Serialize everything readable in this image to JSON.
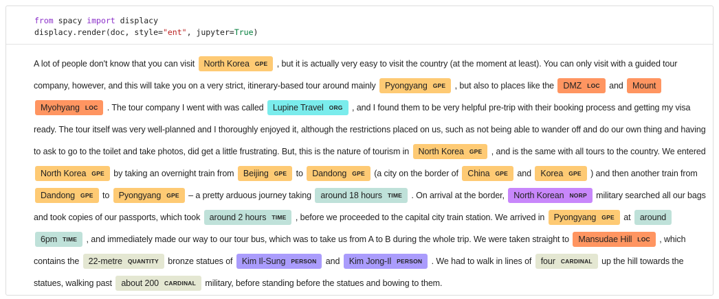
{
  "code": {
    "line1": {
      "kw1": "from",
      "mod": " spacy ",
      "kw2": "import",
      "name": " displacy"
    },
    "line2": {
      "pre": "displacy.render(doc, style=",
      "str": "\"ent\"",
      "mid": ", jupyter=",
      "val": "True",
      "post": ")"
    }
  },
  "segments": [
    {
      "t": "A lot of people don't know that you can visit "
    },
    {
      "e": "North Korea",
      "l": "GPE"
    },
    {
      "t": " , but it is actually very easy to visit the country (at the moment at least). You can only visit with a guided tour company, however, and this will take you on a very strict, itinerary-based tour around mainly "
    },
    {
      "e": "Pyongyang",
      "l": "GPE"
    },
    {
      "t": " , but also to places like the "
    },
    {
      "e": "DMZ",
      "l": "LOC"
    },
    {
      "t": " and "
    },
    {
      "e": "Mount Myohyang",
      "l": "LOC"
    },
    {
      "t": " . The tour company I went with was called "
    },
    {
      "e": "Lupine Travel",
      "l": "ORG"
    },
    {
      "t": " , and I found them to be very helpful pre-trip with their booking process and getting my visa ready. The tour itself was very well-planned and I thoroughly enjoyed it, although the restrictions placed on us, such as not being able to wander off and do our own thing and having to ask to go to the toilet and take photos, did get a little frustrating. But, this is the nature of tourism in "
    },
    {
      "e": "North Korea",
      "l": "GPE"
    },
    {
      "t": " , and is the same with all tours to the country. We entered "
    },
    {
      "e": "North Korea",
      "l": "GPE"
    },
    {
      "t": " by taking an overnight train from "
    },
    {
      "e": "Beijing",
      "l": "GPE"
    },
    {
      "t": " to "
    },
    {
      "e": "Dandong",
      "l": "GPE"
    },
    {
      "t": " (a city on the border of "
    },
    {
      "e": "China",
      "l": "GPE"
    },
    {
      "t": " and "
    },
    {
      "e": "Korea",
      "l": "GPE"
    },
    {
      "t": " ) and then another train from "
    },
    {
      "e": "Dandong",
      "l": "GPE"
    },
    {
      "t": " to "
    },
    {
      "e": "Pyongyang",
      "l": "GPE"
    },
    {
      "t": " – a pretty arduous journey taking "
    },
    {
      "e": "around 18 hours",
      "l": "TIME"
    },
    {
      "t": " . On arrival at the border, "
    },
    {
      "e": "North Korean",
      "l": "NORP"
    },
    {
      "t": " military searched all our bags and took copies of our passports, which took "
    },
    {
      "e": "around 2 hours",
      "l": "TIME"
    },
    {
      "t": " , before we proceeded to the capital city train station. We arrived in "
    },
    {
      "e": "Pyongyang",
      "l": "GPE"
    },
    {
      "t": " at "
    },
    {
      "e": "around 6pm",
      "l": "TIME"
    },
    {
      "t": " , and immediately made our way to our tour bus, which was to take us from A to B during the whole trip. We were taken straight to "
    },
    {
      "e": "Mansudae Hill",
      "l": "LOC"
    },
    {
      "t": " , which contains the "
    },
    {
      "e": "22-metre",
      "l": "QUANTITY"
    },
    {
      "t": " bronze statues of "
    },
    {
      "e": "Kim Il-Sung",
      "l": "PERSON"
    },
    {
      "t": " and "
    },
    {
      "e": "Kim Jong-Il",
      "l": "PERSON"
    },
    {
      "t": " . We had to walk in lines of "
    },
    {
      "e": "four",
      "l": "CARDINAL"
    },
    {
      "t": " up the hill towards the statues, walking past "
    },
    {
      "e": "about 200",
      "l": "CARDINAL"
    },
    {
      "t": " military, before standing before the statues and bowing to them."
    }
  ]
}
